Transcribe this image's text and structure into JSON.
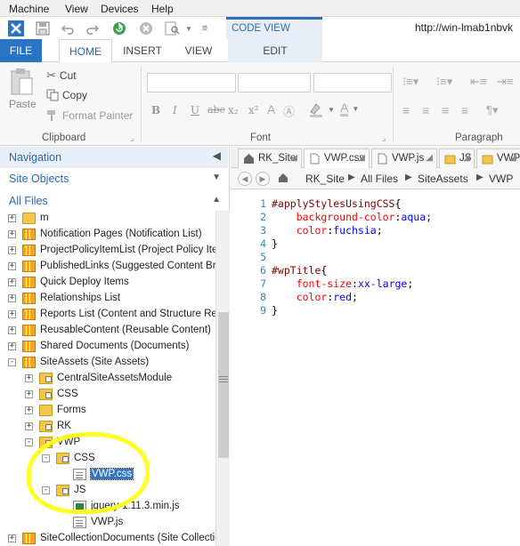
{
  "menubar": {
    "machine": "Machine",
    "view": "View",
    "devices": "Devices",
    "help": "Help"
  },
  "titlebar": {
    "contextual_group": "CODE VIEW TOOLS",
    "url": "http://win-lmab1nbvk"
  },
  "ribbon_tabs": {
    "file": "FILE",
    "home": "HOME",
    "insert": "INSERT",
    "view": "VIEW",
    "edit": "EDIT"
  },
  "clipboard": {
    "paste": "Paste",
    "cut": "Cut",
    "copy": "Copy",
    "format_painter": "Format Painter",
    "group_label": "Clipboard"
  },
  "font": {
    "group_label": "Font",
    "bold": "B",
    "italic": "I",
    "underline": "U",
    "strike": "abc",
    "subscript": "x₂",
    "superscript": "x²"
  },
  "paragraph": {
    "group_label": "Paragraph"
  },
  "navigation": {
    "title": "Navigation",
    "site_objects": "Site Objects",
    "all_files": "All Files",
    "tree": [
      {
        "label": "m",
        "indent": 0,
        "icon": "folder",
        "expander": "+"
      },
      {
        "label": "Notification Pages (Notification List)",
        "indent": 0,
        "icon": "list",
        "expander": "+"
      },
      {
        "label": "ProjectPolicyItemList (Project Policy Item",
        "indent": 0,
        "icon": "list",
        "expander": "+"
      },
      {
        "label": "PublishedLinks (Suggested Content Br",
        "indent": 0,
        "icon": "list",
        "expander": "+"
      },
      {
        "label": "Quick Deploy Items",
        "indent": 0,
        "icon": "list",
        "expander": "+"
      },
      {
        "label": "Relationships List",
        "indent": 0,
        "icon": "list",
        "expander": "+"
      },
      {
        "label": "Reports List (Content and Structure Re",
        "indent": 0,
        "icon": "list",
        "expander": "+"
      },
      {
        "label": "ReusableContent (Reusable Content)",
        "indent": 0,
        "icon": "list",
        "expander": "+"
      },
      {
        "label": "Shared Documents (Documents)",
        "indent": 0,
        "icon": "list",
        "expander": "+"
      },
      {
        "label": "SiteAssets (Site Assets)",
        "indent": 0,
        "icon": "list",
        "expander": "−"
      },
      {
        "label": "CentralSiteAssetsModule",
        "indent": 1,
        "icon": "sitefolder",
        "expander": "+"
      },
      {
        "label": "CSS",
        "indent": 1,
        "icon": "sitefolder",
        "expander": "+"
      },
      {
        "label": "Forms",
        "indent": 1,
        "icon": "folder",
        "expander": "+"
      },
      {
        "label": "RK",
        "indent": 1,
        "icon": "sitefolder",
        "expander": "+"
      },
      {
        "label": "VWP",
        "indent": 1,
        "icon": "sitefolder",
        "expander": "−"
      },
      {
        "label": "CSS",
        "indent": 2,
        "icon": "sitefolder",
        "expander": "−"
      },
      {
        "label": "VWP.css",
        "indent": 3,
        "icon": "file",
        "expander": "",
        "selected": true
      },
      {
        "label": "JS",
        "indent": 2,
        "icon": "sitefolder",
        "expander": "−"
      },
      {
        "label": "jquery-1.11.3.min.js",
        "indent": 3,
        "icon": "js",
        "expander": ""
      },
      {
        "label": "VWP.js",
        "indent": 3,
        "icon": "file",
        "expander": ""
      },
      {
        "label": "SiteCollectionDocuments (Site Collectio",
        "indent": 0,
        "icon": "list",
        "expander": "+"
      }
    ]
  },
  "editor_tabs": [
    {
      "label": "RK_Site",
      "icon": "site",
      "active": false
    },
    {
      "label": "VWP.css",
      "icon": "file",
      "active": true
    },
    {
      "label": "VWP.js",
      "icon": "file",
      "active": false
    },
    {
      "label": "JS",
      "icon": "folder",
      "active": false
    },
    {
      "label": "VWP",
      "icon": "folder",
      "active": false
    }
  ],
  "breadcrumb": [
    "RK_Site",
    "All Files",
    "SiteAssets",
    "VWP"
  ],
  "code_lines": [
    {
      "n": "1",
      "parts": [
        {
          "t": "#applyStylesUsingCSS",
          "k": "sel-c"
        },
        {
          "t": "{",
          "k": "punc"
        }
      ]
    },
    {
      "n": "2",
      "parts": [
        {
          "t": "    background-color",
          "k": "prop"
        },
        {
          "t": ":",
          "k": "punc"
        },
        {
          "t": "aqua",
          "k": "val"
        },
        {
          "t": ";",
          "k": "punc"
        }
      ]
    },
    {
      "n": "3",
      "parts": [
        {
          "t": "    color",
          "k": "prop"
        },
        {
          "t": ":",
          "k": "punc"
        },
        {
          "t": "fuchsia",
          "k": "val"
        },
        {
          "t": ";",
          "k": "punc"
        }
      ]
    },
    {
      "n": "4",
      "parts": [
        {
          "t": "}",
          "k": "punc"
        }
      ]
    },
    {
      "n": "5",
      "parts": []
    },
    {
      "n": "6",
      "parts": [
        {
          "t": "#wpTitle",
          "k": "sel-c"
        },
        {
          "t": "{",
          "k": "punc"
        }
      ]
    },
    {
      "n": "7",
      "parts": [
        {
          "t": "    font-size",
          "k": "prop"
        },
        {
          "t": ":",
          "k": "punc"
        },
        {
          "t": "xx-large",
          "k": "val"
        },
        {
          "t": ";",
          "k": "punc"
        }
      ]
    },
    {
      "n": "8",
      "parts": [
        {
          "t": "    color",
          "k": "prop"
        },
        {
          "t": ":",
          "k": "punc"
        },
        {
          "t": "red",
          "k": "val"
        },
        {
          "t": ";",
          "k": "punc"
        }
      ]
    },
    {
      "n": "9",
      "parts": [
        {
          "t": "}",
          "k": "punc"
        }
      ]
    }
  ],
  "colors": {
    "accent": "#2a74c5",
    "highlight": "#ffff1a",
    "selection": "#3574c4"
  }
}
